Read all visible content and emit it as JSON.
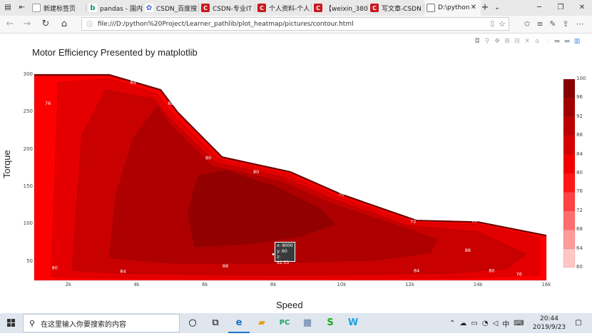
{
  "browser": {
    "tabs": [
      {
        "title": "新建标签页",
        "icon": "blank-page-icon"
      },
      {
        "title": "pandas - 国内",
        "icon": "bing-icon"
      },
      {
        "title": "CSDN_百度搜",
        "icon": "baidu-icon"
      },
      {
        "title": "CSDN-专业IT",
        "icon": "csdn-icon"
      },
      {
        "title": "个人资料-个人",
        "icon": "csdn-icon"
      },
      {
        "title": "【weixin_380",
        "icon": "csdn-icon"
      },
      {
        "title": "写文章-CSDN",
        "icon": "csdn-icon"
      },
      {
        "title": "D:\\python",
        "icon": "document-icon",
        "active": true
      }
    ],
    "new_tab": "+",
    "url": "file:///D:/python%20Project/Learner_pathlib/plot_heatmap/pictures/contour.html"
  },
  "plot": {
    "title": "Motor Efficiency Presented by matplotlib",
    "xlabel": "Speed",
    "ylabel": "Torque",
    "hover": {
      "x": "x: 8000",
      "y": "y: 60",
      "z": "z: 92.53"
    }
  },
  "chart_data": {
    "type": "contour",
    "title": "Motor Efficiency Presented by matplotlib",
    "xlabel": "Speed",
    "ylabel": "Torque",
    "xlim": [
      1000,
      16000
    ],
    "ylim": [
      25,
      300
    ],
    "x_ticks": [
      2000,
      4000,
      6000,
      8000,
      10000,
      12000,
      14000,
      16000
    ],
    "x_tick_labels": [
      "2k",
      "4k",
      "6k",
      "8k",
      "10k",
      "12k",
      "14k",
      "16k"
    ],
    "y_ticks": [
      50,
      100,
      150,
      200,
      250,
      300
    ],
    "colorbar": {
      "min": 60,
      "max": 100,
      "ticks": [
        60,
        64,
        68,
        72,
        76,
        80,
        84,
        88,
        92,
        96,
        100
      ]
    },
    "torque_limit": [
      [
        1000,
        300
      ],
      [
        3200,
        300
      ],
      [
        4700,
        280
      ],
      [
        5200,
        250
      ],
      [
        6500,
        190
      ],
      [
        8500,
        170
      ],
      [
        10000,
        140
      ],
      [
        12200,
        105
      ],
      [
        14000,
        103
      ],
      [
        16000,
        85
      ]
    ],
    "regions": [
      {
        "level": 80,
        "points": [
          [
            1000,
            25
          ],
          [
            1000,
            300
          ],
          [
            3200,
            300
          ],
          [
            4700,
            280
          ],
          [
            5200,
            250
          ],
          [
            6500,
            190
          ],
          [
            8500,
            170
          ],
          [
            10000,
            140
          ],
          [
            12200,
            105
          ],
          [
            14000,
            103
          ],
          [
            16000,
            85
          ],
          [
            16000,
            25
          ]
        ]
      },
      {
        "level": 84,
        "points": [
          [
            1500,
            30
          ],
          [
            1700,
            290
          ],
          [
            3200,
            295
          ],
          [
            4600,
            275
          ],
          [
            5100,
            245
          ],
          [
            6400,
            187
          ],
          [
            8400,
            167
          ],
          [
            9900,
            137
          ],
          [
            12100,
            102
          ],
          [
            14000,
            100
          ],
          [
            15800,
            82
          ],
          [
            15800,
            32
          ],
          [
            13500,
            28
          ],
          [
            8000,
            27
          ],
          [
            3000,
            28
          ]
        ]
      },
      {
        "level": 88,
        "points": [
          [
            2100,
            38
          ],
          [
            2400,
            220
          ],
          [
            3100,
            280
          ],
          [
            4500,
            268
          ],
          [
            5000,
            240
          ],
          [
            6300,
            183
          ],
          [
            8300,
            163
          ],
          [
            9800,
            133
          ],
          [
            11900,
            99
          ],
          [
            14000,
            90
          ],
          [
            15400,
            60
          ],
          [
            14800,
            40
          ],
          [
            13000,
            34
          ],
          [
            8000,
            32
          ],
          [
            3800,
            34
          ]
        ]
      },
      {
        "level": 92,
        "points": [
          [
            3200,
            55
          ],
          [
            3400,
            140
          ],
          [
            3900,
            215
          ],
          [
            4600,
            258
          ],
          [
            5000,
            232
          ],
          [
            6200,
            178
          ],
          [
            8200,
            158
          ],
          [
            9700,
            128
          ],
          [
            11800,
            96
          ],
          [
            12800,
            80
          ],
          [
            12600,
            62
          ],
          [
            11000,
            52
          ],
          [
            8000,
            48
          ],
          [
            5000,
            48
          ]
        ]
      },
      {
        "level": 96,
        "points": [
          [
            5700,
            70
          ],
          [
            5500,
            115
          ],
          [
            5800,
            165
          ],
          [
            6600,
            172
          ],
          [
            8100,
            150
          ],
          [
            9400,
            120
          ],
          [
            9800,
            100
          ],
          [
            8800,
            84
          ],
          [
            7300,
            74
          ]
        ]
      }
    ],
    "contour_labels": [
      {
        "text": "76",
        "x": 1400,
        "y": 260
      },
      {
        "text": "84",
        "x": 3900,
        "y": 288
      },
      {
        "text": "88",
        "x": 5000,
        "y": 260
      },
      {
        "text": "80",
        "x": 6100,
        "y": 187
      },
      {
        "text": "80",
        "x": 7500,
        "y": 168
      },
      {
        "text": "76",
        "x": 10000,
        "y": 138
      },
      {
        "text": "72",
        "x": 12100,
        "y": 102
      },
      {
        "text": "88",
        "x": 13900,
        "y": 103
      },
      {
        "text": "88",
        "x": 13700,
        "y": 63
      },
      {
        "text": "80",
        "x": 1600,
        "y": 40
      },
      {
        "text": "84",
        "x": 3600,
        "y": 35
      },
      {
        "text": "88",
        "x": 6600,
        "y": 42
      },
      {
        "text": "84",
        "x": 12200,
        "y": 36
      },
      {
        "text": "80",
        "x": 14400,
        "y": 36
      },
      {
        "text": "76",
        "x": 15200,
        "y": 31
      }
    ]
  },
  "taskbar": {
    "search_placeholder": "在这里输入你要搜索的内容",
    "clock_time": "20:44",
    "clock_date": "2019/9/23",
    "ime": "中"
  }
}
